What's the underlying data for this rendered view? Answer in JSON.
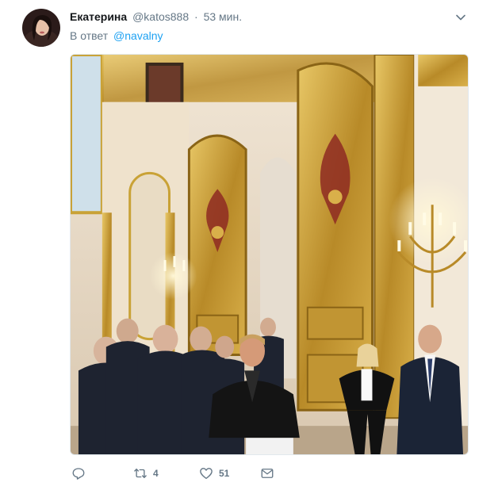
{
  "tweet": {
    "author_name": "Екатерина",
    "handle": "@katos888",
    "separator": "·",
    "time": "53 мин.",
    "reply_prefix": "В ответ",
    "reply_to": "@navalny",
    "image_alt": "Photo in an ornate gold palace hall with people standing near a large gilded door"
  },
  "actions": {
    "reply_icon": "reply-icon",
    "retweet_icon": "retweet-icon",
    "retweet_count": "4",
    "like_icon": "heart-icon",
    "like_count": "51",
    "dm_icon": "envelope-icon"
  },
  "colors": {
    "link": "#1da1f2",
    "secondary_text": "#657786",
    "primary_text": "#14171a",
    "gold": "#c9a236"
  }
}
